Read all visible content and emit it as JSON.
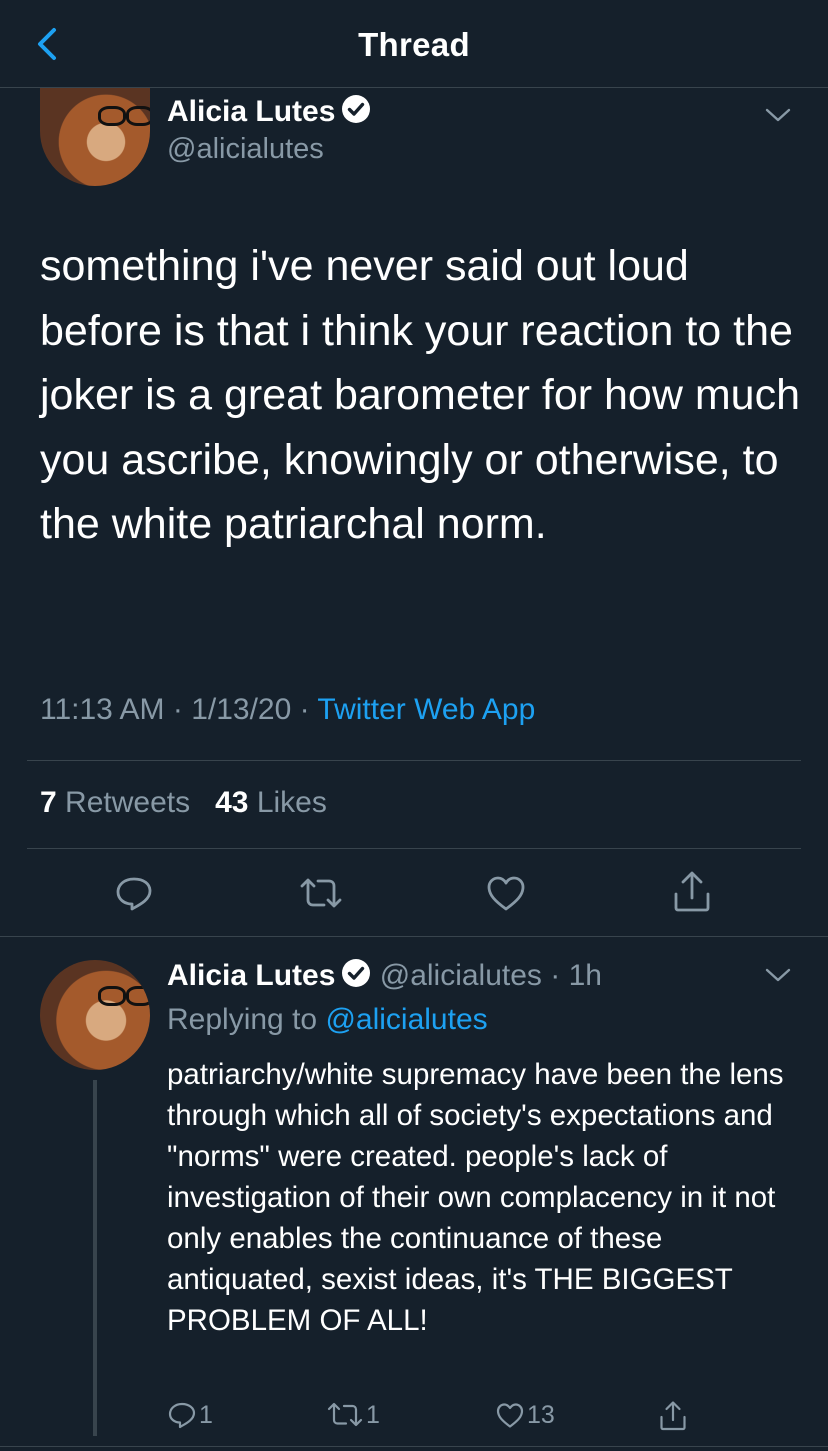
{
  "header": {
    "title": "Thread"
  },
  "main_tweet": {
    "name": "Alicia Lutes",
    "handle": "@alicialutes",
    "text": "something i've never said out loud before is that i think your reaction to the joker is a great barometer for how much you ascribe, knowingly or otherwise, to the white patriarchal norm.",
    "time": "11:13 AM",
    "date": "1/13/20",
    "app": "Twitter Web App",
    "retweets_count": "7",
    "retweets_label": "Retweets",
    "likes_count": "43",
    "likes_label": "Likes"
  },
  "reply_tweet": {
    "name": "Alicia Lutes",
    "handle": "@alicialutes",
    "age": "1h",
    "replying_prefix": "Replying to",
    "replying_to": "@alicialutes",
    "text": "patriarchy/white supremacy have been the lens through which all of society's expectations and \"norms\" were created. people's lack of investigation of their own complacency in it not only enables the continuance of these antiquated, sexist ideas, it's THE BIGGEST PROBLEM OF ALL!",
    "reply_count": "1",
    "retweet_count": "1",
    "like_count": "13"
  },
  "colors": {
    "background": "#15202b",
    "accent": "#1da1f2",
    "secondary_text": "#8899a6",
    "divider": "#38444d"
  },
  "icons": [
    "back-arrow-icon",
    "verified-badge-icon",
    "chevron-down-icon",
    "reply-icon",
    "retweet-icon",
    "like-icon",
    "share-icon"
  ]
}
